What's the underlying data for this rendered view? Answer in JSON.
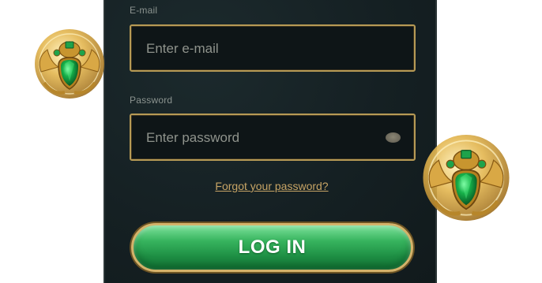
{
  "login_form": {
    "email_label": "E-mail",
    "email_placeholder": "Enter e-mail",
    "password_label": "Password",
    "password_placeholder": "Enter password",
    "forgot_password_link": "Forgot your password?",
    "login_button": "LOG IN"
  },
  "decorations": {
    "icon_left": "scarab-emblem-icon",
    "icon_right": "scarab-emblem-icon",
    "accent_gold": "#b79a55",
    "button_green": "#2aa452",
    "panel_background": "#152023"
  }
}
